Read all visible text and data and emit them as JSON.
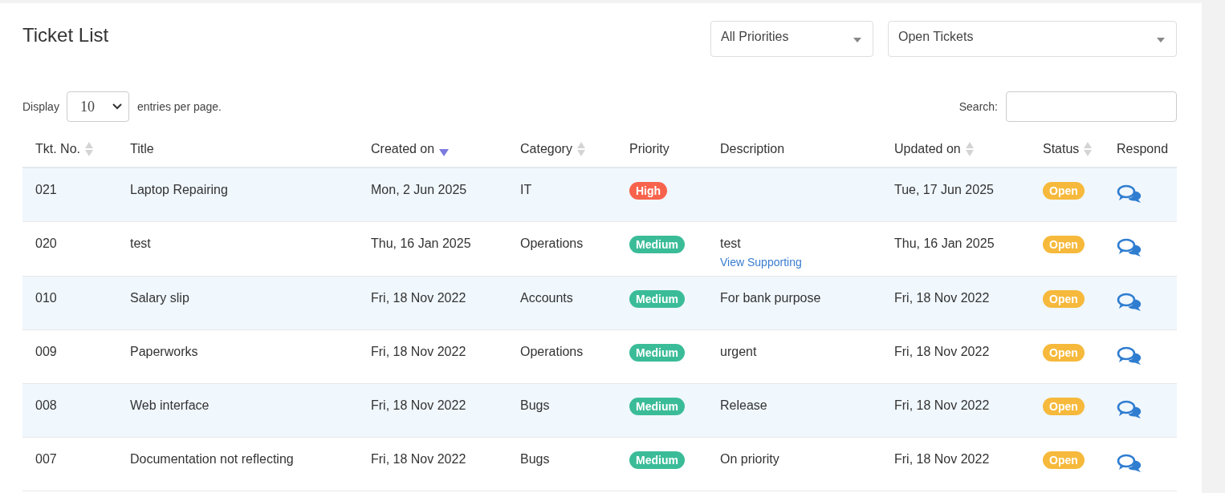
{
  "title": "Ticket List",
  "filters": [
    {
      "value": "All Priorities"
    },
    {
      "value": "Open Tickets"
    }
  ],
  "length_control": {
    "label_before": "Display",
    "value": "10",
    "label_after": "entries per page."
  },
  "search": {
    "label": "Search:"
  },
  "columns": [
    {
      "label": "Tkt. No.",
      "sortable": true,
      "sorted": false
    },
    {
      "label": "Title",
      "sortable": false,
      "sorted": false
    },
    {
      "label": "Created on",
      "sortable": true,
      "sorted": true
    },
    {
      "label": "Category",
      "sortable": true,
      "sorted": false
    },
    {
      "label": "Priority",
      "sortable": false,
      "sorted": false
    },
    {
      "label": "Description",
      "sortable": false,
      "sorted": false
    },
    {
      "label": "Updated on",
      "sortable": true,
      "sorted": false
    },
    {
      "label": "Status",
      "sortable": true,
      "sorted": false
    },
    {
      "label": "Respond",
      "sortable": false,
      "sorted": false
    }
  ],
  "rows": [
    {
      "number": "021",
      "title": "Laptop Repairing",
      "created": "Mon, 2 Jun 2025",
      "category": "IT",
      "priority": {
        "label": "High",
        "color": "#f8634c"
      },
      "updated": "Tue, 17 Jun 2025",
      "status": {
        "label": "Open",
        "color": "#f6b93b"
      }
    },
    {
      "number": "020",
      "title": "test",
      "created": "Thu, 16 Jan 2025",
      "category": "Operations",
      "priority": {
        "label": "Medium",
        "color": "#3bbc98"
      },
      "description": "test",
      "link": "View Supporting",
      "updated": "Thu, 16 Jan 2025",
      "status": {
        "label": "Open",
        "color": "#f6b93b"
      }
    },
    {
      "number": "010",
      "title": "Salary slip",
      "created": "Fri, 18 Nov 2022",
      "category": "Accounts",
      "priority": {
        "label": "Medium",
        "color": "#3bbc98"
      },
      "description": "For bank purpose",
      "updated": "Fri, 18 Nov 2022",
      "status": {
        "label": "Open",
        "color": "#f6b93b"
      }
    },
    {
      "number": "009",
      "title": "Paperworks",
      "created": "Fri, 18 Nov 2022",
      "category": "Operations",
      "priority": {
        "label": "Medium",
        "color": "#3bbc98"
      },
      "description": "urgent",
      "updated": "Fri, 18 Nov 2022",
      "status": {
        "label": "Open",
        "color": "#f6b93b"
      }
    },
    {
      "number": "008",
      "title": "Web interface",
      "created": "Fri, 18 Nov 2022",
      "category": "Bugs",
      "priority": {
        "label": "Medium",
        "color": "#3bbc98"
      },
      "description": "Release",
      "updated": "Fri, 18 Nov 2022",
      "status": {
        "label": "Open",
        "color": "#f6b93b"
      }
    },
    {
      "number": "007",
      "title": "Documentation not reflecting",
      "created": "Fri, 18 Nov 2022",
      "category": "Bugs",
      "priority": {
        "label": "Medium",
        "color": "#3bbc98"
      },
      "description": "On priority",
      "updated": "Fri, 18 Nov 2022",
      "status": {
        "label": "Open",
        "color": "#f6b93b"
      }
    }
  ]
}
